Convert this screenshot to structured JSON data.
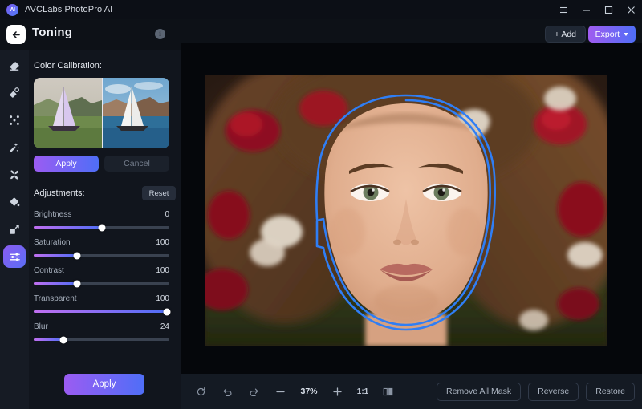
{
  "titlebar": {
    "app_name": "AVCLabs PhotoPro AI",
    "logo_text": "AI",
    "menu_icon": "hamburger-icon",
    "minimize_icon": "minimize-icon",
    "maximize_icon": "maximize-icon",
    "close_icon": "close-icon"
  },
  "header": {
    "back_icon": "back-arrow-icon",
    "title": "Toning",
    "info_icon": "i",
    "add_label": "+ Add",
    "export_label": "Export"
  },
  "rail": {
    "items": [
      {
        "icon": "eraser-icon",
        "active": false
      },
      {
        "icon": "object-remove-icon",
        "active": false
      },
      {
        "icon": "expand-icon",
        "active": false
      },
      {
        "icon": "magic-wand-icon",
        "active": false
      },
      {
        "icon": "enhance-icon",
        "active": false
      },
      {
        "icon": "color-drop-icon",
        "active": false
      },
      {
        "icon": "resize-icon",
        "active": false
      },
      {
        "icon": "toning-sliders-icon",
        "active": true
      }
    ]
  },
  "panel": {
    "calibration_label": "Color Calibration:",
    "calibration_preview": {
      "before_alt": "sailboat-before-thumbnail",
      "after_alt": "sailboat-after-thumbnail"
    },
    "apply_small_label": "Apply",
    "cancel_small_label": "Cancel",
    "adjustments_label": "Adjustments:",
    "reset_label": "Reset",
    "sliders": [
      {
        "name": "Brightness",
        "value": "0",
        "percent": 50
      },
      {
        "name": "Saturation",
        "value": "100",
        "percent": 32
      },
      {
        "name": "Contrast",
        "value": "100",
        "percent": 32
      },
      {
        "name": "Transparent",
        "value": "100",
        "percent": 98
      },
      {
        "name": "Blur",
        "value": "24",
        "percent": 22
      }
    ],
    "apply_label": "Apply"
  },
  "canvas": {
    "image_alt": "portrait-woman-with-roses",
    "mask_color": "#2f7ef5"
  },
  "bottombar": {
    "reset_icon": "reset-view-icon",
    "undo_icon": "undo-icon",
    "redo_icon": "redo-icon",
    "zoom_out_icon": "minus-icon",
    "zoom_level": "37%",
    "zoom_in_icon": "plus-icon",
    "actual_size_label": "1:1",
    "compare_icon": "compare-split-icon",
    "remove_all_mask_label": "Remove All Mask",
    "reverse_label": "Reverse",
    "restore_label": "Restore"
  },
  "colors": {
    "accent_purple": "#9b5cf2",
    "accent_blue": "#4f6ef7",
    "mask_blue": "#2f7ef5",
    "bg_dark": "#0d1117",
    "panel_bg": "#11151d",
    "rail_bg": "#161b24"
  }
}
